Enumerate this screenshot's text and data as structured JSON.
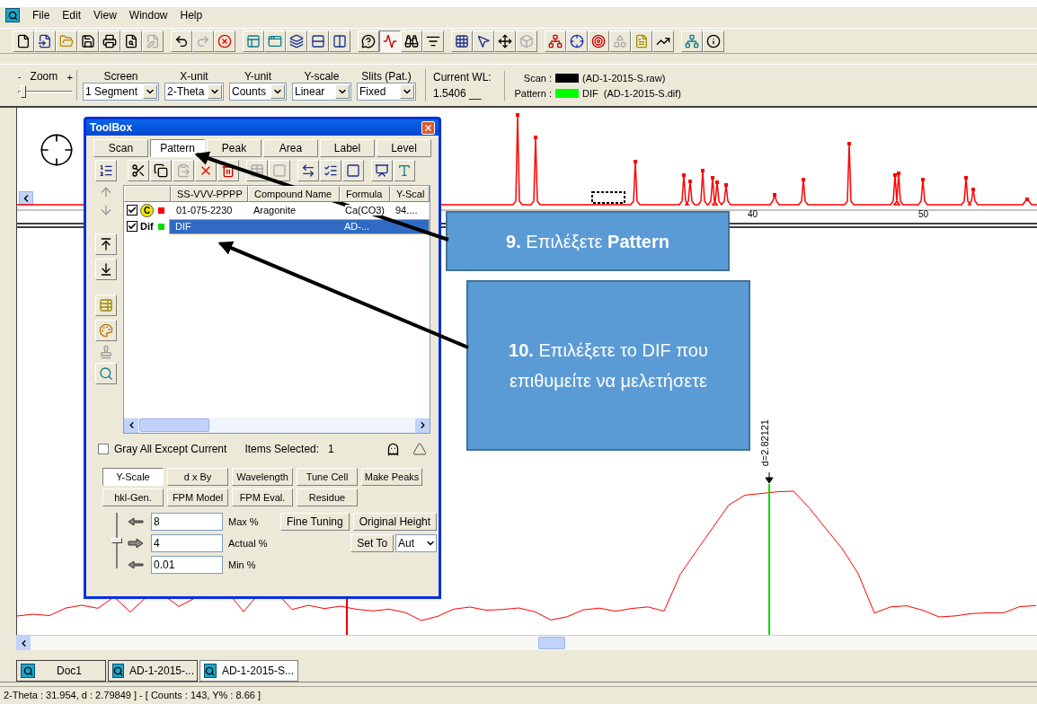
{
  "menu": {
    "items": [
      "File",
      "Edit",
      "View",
      "Window",
      "Help"
    ]
  },
  "controls": {
    "zoom": {
      "label": "Zoom",
      "minus": "-",
      "plus": "+",
      "level": 0.05
    },
    "selects": [
      {
        "label": "Screen",
        "value": "1 Segment"
      },
      {
        "label": "X-unit",
        "value": "2-Theta"
      },
      {
        "label": "Y-unit",
        "value": "Counts"
      },
      {
        "label": "Y-scale",
        "value": "Linear"
      },
      {
        "label": "Slits (Pat.)",
        "value": "Fixed"
      }
    ],
    "current_wl": {
      "label": "Current WL:",
      "value": "1.5406 __"
    },
    "legend": [
      {
        "label": "Scan :",
        "color": "#000000",
        "text": "(AD-1-2015-S.raw)"
      },
      {
        "label": "Pattern :",
        "color": "#00ff00",
        "text": "DIF  (AD-1-2015-S.dif)"
      }
    ]
  },
  "chart": {
    "axis_labels": [
      "40",
      "50"
    ],
    "peak_label": "d=2.82121"
  },
  "toolbox": {
    "title": "ToolBox",
    "tabs": [
      {
        "label": "Scan",
        "selected": false
      },
      {
        "label": "Pattern",
        "selected": true
      },
      {
        "label": "Peak",
        "selected": false
      },
      {
        "label": "Area",
        "selected": false
      },
      {
        "label": "Label",
        "selected": false
      },
      {
        "label": "Level",
        "selected": false
      }
    ],
    "columns": [
      "SS-VVV-PPPP",
      "Compound Name",
      "Formula",
      "Y-Scal"
    ],
    "rows": [
      {
        "checked": true,
        "tag": {
          "kind": "circle",
          "text": "C"
        },
        "color": "#ff0000",
        "selected": false,
        "cells": {
          "ss": "01-075-2230",
          "name": "Aragonite",
          "formula": "Ca(CO3)",
          "yscale": "94...."
        }
      },
      {
        "checked": true,
        "tag": {
          "kind": "text",
          "text": "Dif"
        },
        "color": "#00dd00",
        "selected": true,
        "cells": {
          "ss": "DIF",
          "formula": "AD-..."
        }
      }
    ],
    "gray_all": {
      "label": "Gray All Except Current",
      "checked": false
    },
    "items_selected": {
      "label": "Items Selected:",
      "value": "1"
    },
    "mode_buttons": [
      {
        "label": "Y-Scale",
        "selected": true
      },
      {
        "label": "d x By",
        "selected": false
      },
      {
        "label": "Wavelength",
        "selected": false
      },
      {
        "label": "Tune Cell",
        "selected": false
      },
      {
        "label": "Make Peaks",
        "selected": false
      },
      {
        "label": "hkl-Gen.",
        "selected": false
      },
      {
        "label": "FPM Model",
        "selected": false
      },
      {
        "label": "FPM Eval.",
        "selected": false
      },
      {
        "label": "Residue",
        "selected": false
      }
    ],
    "scale_slider": {
      "level": 0.5
    },
    "fields": [
      {
        "value": "8",
        "label": "Max %"
      },
      {
        "value": "4",
        "label": "Actual %"
      },
      {
        "value": "0.01",
        "label": "Min %"
      }
    ],
    "fine_tuning": "Fine Tuning",
    "original_height": "Original Height",
    "set_to": "Set To",
    "set_to_value": "Aut"
  },
  "callouts": [
    "**9.** Επιλέξετε **Pattern**",
    "**10.** Επιλέξετε το DIF που επιθυμείτε να μελετήσετε"
  ],
  "document_tabs": [
    {
      "label": "Doc1",
      "selected": false
    },
    {
      "label": "AD-1-2015-...",
      "selected": false
    },
    {
      "label": "AD-1-2015-S...",
      "selected": true
    }
  ],
  "status_bar": "2-Theta : 31.954, d : 2.79849 ] - [ Counts : 143, Y% : 8.66 ]"
}
